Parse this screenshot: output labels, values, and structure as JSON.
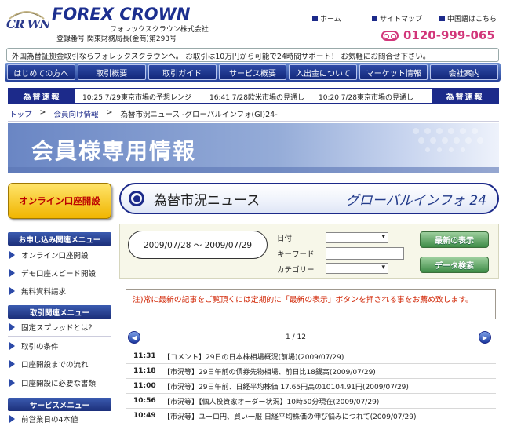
{
  "header": {
    "logo_short": "CR WN",
    "logo_name": "FOREX CROWN",
    "company_name": "フォレックスクラウン株式会社",
    "registration": "登録番号 関東財務局長(金商)第293号",
    "links": [
      "ホーム",
      "サイトマップ",
      "中国語はこちら"
    ],
    "phone": "0120-999-065"
  },
  "info_banner": "外国為替証拠金取引ならフォレックスクラウンへ。 お取引は10万円から可能で24時間サポート！ お気軽にお問合せ下さい。",
  "nav": [
    "はじめての方へ",
    "取引概要",
    "取引ガイド",
    "サービス概要",
    "入出金について",
    "マーケット情報",
    "会社案内"
  ],
  "rates": {
    "label_left": "為替速報",
    "label_right": "為替速報",
    "items": [
      "10:25 7/29東京市場の予想レンジ",
      "16:41 7/28欧米市場の見通し",
      "10:20 7/28東京市場の見通し"
    ]
  },
  "breadcrumb": [
    "トップ",
    ">",
    "会員向け情報",
    ">",
    "為替市況ニュース -グローバルインフォ(GI)24-"
  ],
  "banner_title": "会員様専用情報",
  "sidebar": {
    "open_account": "オンライン口座開設",
    "sections": [
      {
        "title": "お申し込み関連メニュー",
        "items": [
          "オンライン口座開設",
          "デモ口座スピード開設",
          "無料資料請求"
        ]
      },
      {
        "title": "取引関連メニュー",
        "items": [
          "固定スプレッドとは？",
          "取引の条件",
          "口座開設までの流れ",
          "口座開設に必要な書類"
        ]
      },
      {
        "title": "サービスメニュー",
        "items": [
          "前営業日の4本値"
        ]
      }
    ]
  },
  "content": {
    "title": "為替市況ニュース",
    "subtitle": "グローバルインフォ 24",
    "date_range": "2009/07/28 〜 2009/07/29",
    "filters": {
      "date_label": "日付",
      "keyword_label": "キーワード",
      "category_label": "カテゴリー",
      "date_value": "",
      "keyword_value": "",
      "category_value": ""
    },
    "buttons": {
      "latest": "最新の表示",
      "search": "データ検索"
    },
    "notice": "注)常に最新の記事をご覧頂くには定期的に「最新の表示」ボタンを押される事をお薦め致します。",
    "page_counter": "1 / 12",
    "news": [
      {
        "time": "11:31",
        "title": "【コメント】29日の日本株相場概況(前場)(2009/07/29)"
      },
      {
        "time": "11:18",
        "title": "【市況等】29日午前の債券先物相場、前日比18銭高(2009/07/29)"
      },
      {
        "time": "11:00",
        "title": "【市況等】29日午前、日経平均株価 17.65円高の10104.91円(2009/07/29)"
      },
      {
        "time": "10:56",
        "title": "【市況等】【個人投資家オーダー状況】10時50分現在(2009/07/29)"
      },
      {
        "time": "10:49",
        "title": "【市況等】ユーロ円、買い一服 日経平均株価の伸び悩みにつれて(2009/07/29)"
      }
    ]
  }
}
